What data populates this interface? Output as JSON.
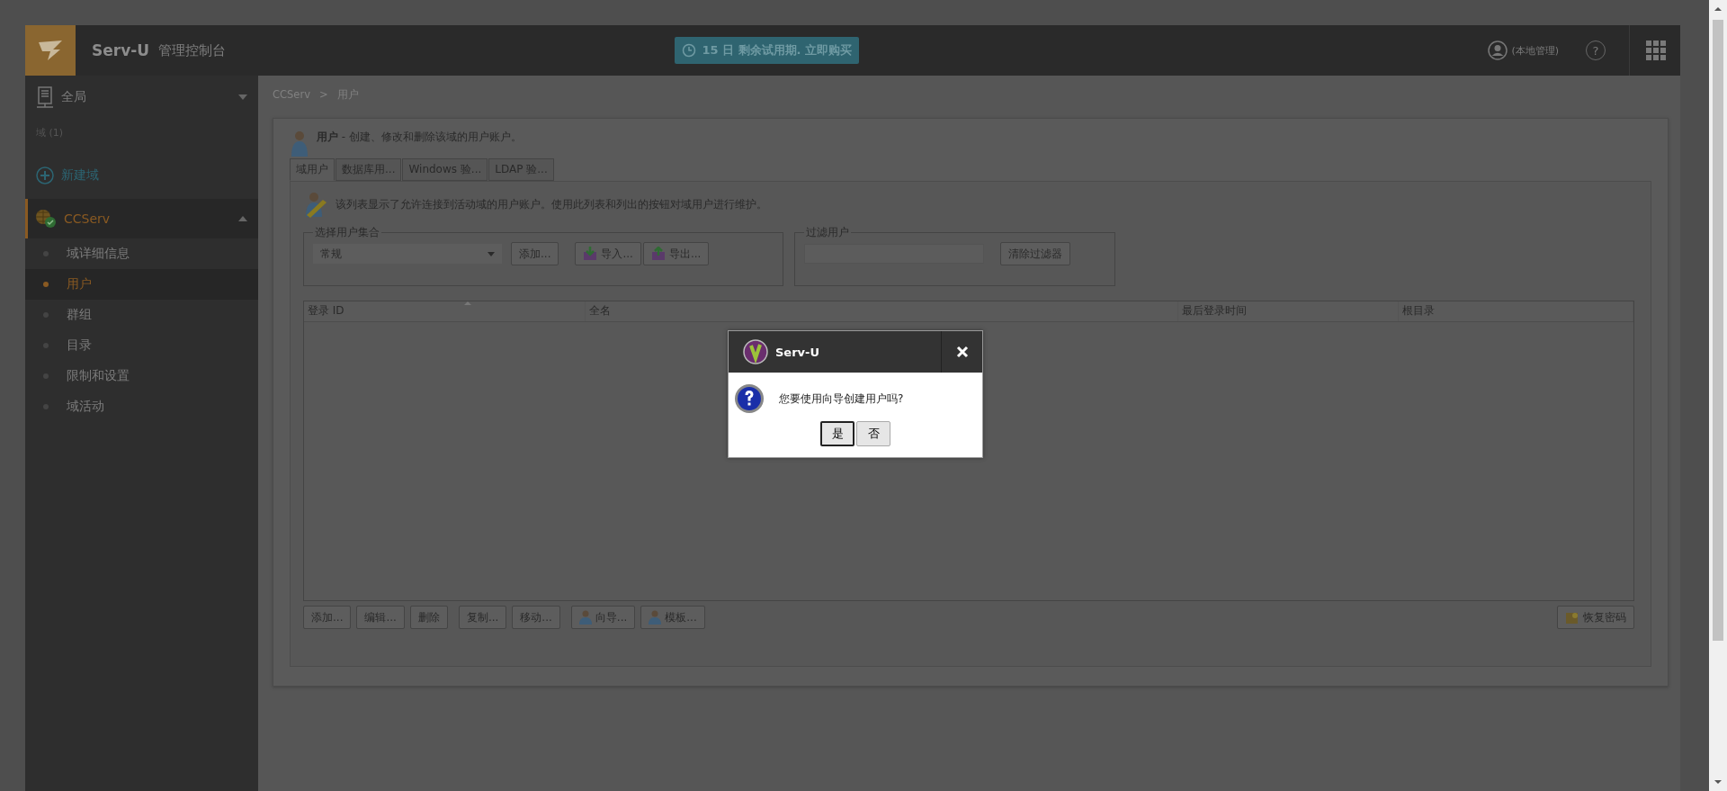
{
  "header": {
    "logo_text": "Serv-U",
    "subtitle": "管理控制台",
    "trial": "15 日 剩余试用期. 立即购买",
    "user": "(本地管理)",
    "help": "?"
  },
  "sidebar": {
    "global": "全局",
    "domains_label": "域 (1)",
    "new_domain": "新建域",
    "domain": {
      "name": "CCServ",
      "expanded": true
    },
    "items": [
      {
        "label": "域详细信息",
        "selected": false
      },
      {
        "label": "用户",
        "selected": true
      },
      {
        "label": "群组",
        "selected": false
      },
      {
        "label": "目录",
        "selected": false
      },
      {
        "label": "限制和设置",
        "selected": false
      },
      {
        "label": "域活动",
        "selected": false
      }
    ]
  },
  "breadcrumb": [
    "CCServ",
    ">",
    "用户"
  ],
  "page_title": "**用户** - 创建、修改和删除该域的用户账户。",
  "tabs": [
    {
      "label": "域用户",
      "selected": true
    },
    {
      "label": "数据库用...",
      "selected": false
    },
    {
      "label": "Windows 验...",
      "selected": false
    },
    {
      "label": "LDAP 验...",
      "selected": false
    }
  ],
  "description": "该列表显示了允许连接到活动域的用户账户。使用此列表和列出的按钮对域用户进行维护。",
  "collection": {
    "legend": "选择用户集合",
    "value": "常规",
    "buttons": [
      {
        "label": "添加...",
        "kind": "plain"
      },
      {
        "label": "导入...",
        "kind": "import"
      },
      {
        "label": "导出...",
        "kind": "export"
      }
    ]
  },
  "filter": {
    "legend": "过滤用户",
    "clear": "清除过滤器"
  },
  "table": {
    "columns": [
      {
        "label": "登录 ID",
        "sorted": true
      },
      {
        "label": "全名",
        "sorted": false
      },
      {
        "label": "最后登录时间",
        "sorted": false
      },
      {
        "label": "根目录",
        "sorted": false
      }
    ]
  },
  "actions": [
    {
      "label": "添加...",
      "kind": "plain"
    },
    {
      "label": "编辑...",
      "kind": "plain"
    },
    {
      "label": "删除",
      "kind": "plain"
    },
    {
      "label": "复制...",
      "kind": "plain"
    },
    {
      "label": "移动...",
      "kind": "plain"
    },
    {
      "label": "向导...",
      "kind": "person"
    },
    {
      "label": "模板...",
      "kind": "person"
    }
  ],
  "recover": {
    "label": "恢复密码"
  },
  "dialog": {
    "title": "Serv-U",
    "message": "您要使用向导创建用户吗?",
    "buttons": [
      {
        "label": "是",
        "selected": true
      },
      {
        "label": "否",
        "selected": false
      }
    ]
  }
}
